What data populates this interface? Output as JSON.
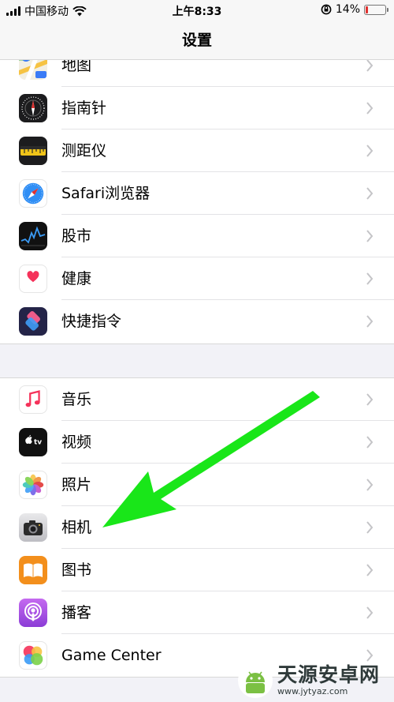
{
  "status_bar": {
    "carrier": "中国移动",
    "time": "上午8:33",
    "battery_percent": "14%",
    "battery_level": 0.14
  },
  "nav": {
    "title": "设置"
  },
  "groups": [
    {
      "items": [
        {
          "label": "地图",
          "icon": "maps-icon"
        },
        {
          "label": "指南针",
          "icon": "compass-icon"
        },
        {
          "label": "测距仪",
          "icon": "measure-icon"
        },
        {
          "label": "Safari浏览器",
          "icon": "safari-icon"
        },
        {
          "label": "股市",
          "icon": "stocks-icon"
        },
        {
          "label": "健康",
          "icon": "health-icon"
        },
        {
          "label": "快捷指令",
          "icon": "shortcuts-icon"
        }
      ]
    },
    {
      "items": [
        {
          "label": "音乐",
          "icon": "music-icon"
        },
        {
          "label": "视频",
          "icon": "tv-icon"
        },
        {
          "label": "照片",
          "icon": "photos-icon"
        },
        {
          "label": "相机",
          "icon": "camera-icon"
        },
        {
          "label": "图书",
          "icon": "books-icon"
        },
        {
          "label": "播客",
          "icon": "podcasts-icon"
        },
        {
          "label": "Game Center",
          "icon": "game-center-icon"
        }
      ]
    }
  ],
  "annotation": {
    "arrow_color": "#19e619",
    "target": "相机"
  },
  "watermark": {
    "title": "天源安卓网",
    "url": "www.jytyaz.com"
  }
}
